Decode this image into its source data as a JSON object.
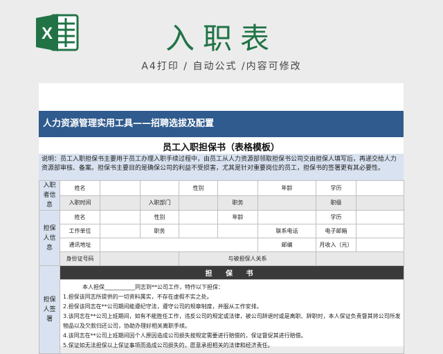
{
  "header": {
    "title": "入职表",
    "subtitle": "A4打印 / 自动公式 /内容可修改",
    "logo_letter": "X"
  },
  "sheet": {
    "section_title": "人力资源管理实用工具——招聘选拔及配置",
    "doc_title": "员工入职担保书（表格模板）",
    "description": "说明：员工入职担保书主要用于员工办理入职手续过程中，由员工从人力资源部领取担保书公司交由担保人填写后，再递交给人力资源部审核、备案。担保书主要目的是确保公司的利益不受损害，尤其是针对重要岗位的员工，担保书的签署更有其必要性。",
    "employee": {
      "group": "入职者信息",
      "name": "姓名",
      "gender": "性别",
      "age": "年龄",
      "education": "学历",
      "hire_date": "入职时间",
      "department": "入职部门",
      "position": "职务",
      "level": "职级"
    },
    "guarantor": {
      "group": "担保人信息",
      "name": "姓名",
      "gender": "性别",
      "age": "年龄",
      "education": "学历",
      "employer": "工作单位",
      "position": "职务",
      "phone": "联系电话",
      "email": "电子邮箱",
      "address": "通讯地址",
      "postcode": "邮编",
      "income": "月收入（元）",
      "id_number": "身份证号码",
      "relation": "与被担保人关系"
    },
    "guarantee": {
      "group": "担保人签署",
      "heading": "担 保 书",
      "intro": "本人担保___________同志到**公司工作，特作以下担保：",
      "clauses": [
        "1.担保该同志所提供的一切资料属实，不存在虚假不实之处。",
        "2.担保该同志在**公司期间能遵纪守法，遵守公司的规章制度，并服从工作安排。",
        "3.该同志在**公司上班期间，如有不能胜任工作，违反公司的规定或法律，被公司辞退时或是离职、辞职时，本人保证负责督其将公司所发物品以及欠款归还公司，协助办理好相关离职手续。",
        "4.该同志在**公司上班期间因个人原因造成公司损失按规定需要进行赔偿的，保证督促其进行赔偿。",
        "5.保证如无法担保以上保证事项而造成公司损失的，愿意承担相关的法律和经济责任。"
      ]
    }
  },
  "colors": {
    "brand_green": "#217346",
    "section_blue": "#2f5b8e",
    "light_blue": "#d9e2f0",
    "dark_header": "#3a3a3a"
  }
}
